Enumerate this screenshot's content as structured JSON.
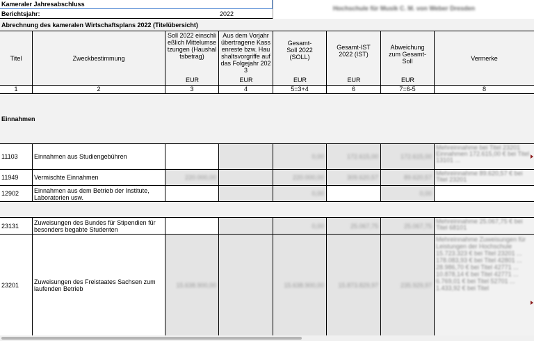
{
  "header": {
    "title": "Kameraler Jahresabschluss",
    "report_year_label": "Berichtsjahr:",
    "report_year": "2022",
    "institution": "Hochschule für Musik C. M. von Weber Dresden"
  },
  "section_title": "Abrechnung des kameralen Wirtschaftsplans  2022 (Titelübersicht)",
  "columns": [
    {
      "label": "Titel",
      "unit": "",
      "num": "1"
    },
    {
      "label": "Zweckbestimmung",
      "unit": "",
      "num": "2"
    },
    {
      "label": "Soll 2022 einschließlich Mittelumsetzungen (Haushaltsbetrag)",
      "unit": "EUR",
      "num": "3"
    },
    {
      "label": "Aus dem Vorjahr übertragene Kassenreste bzw. Haushaltsvorgriffe auf das Folgejahr 2023",
      "unit": "EUR",
      "num": "4"
    },
    {
      "label": "Gesamt-Soll 2022 (SOLL)",
      "unit": "EUR",
      "num": "5=3+4"
    },
    {
      "label": "Gesamt-IST 2022 (IST)",
      "unit": "EUR",
      "num": "6"
    },
    {
      "label": "Abweichung zum Gesamt-Soll",
      "unit": "EUR",
      "num": "7=6-5"
    },
    {
      "label": "Vermerke",
      "unit": "",
      "num": "8"
    }
  ],
  "group_label": "Einnahmen",
  "rows": [
    {
      "titel": "11103",
      "zweck": "Einnahmen aus Studiengebühren",
      "c3": "",
      "c4": "",
      "c5": "0,00",
      "c6": "172.615,00",
      "c7": "172.615,00",
      "note": "Mehreinnahme bei Titel 23201 Einnahmen 172.615,00 € bei Titel 13101 ..."
    },
    {
      "titel": "11949",
      "zweck": "Vermischte Einnahmen",
      "c3": "220.000,00",
      "c4": "",
      "c5": "220.000,00",
      "c6": "309.620,57",
      "c7": "89.620,57",
      "note": "Mehreinnahme 89.620,57 € bei Titel 23201"
    },
    {
      "titel": "12902",
      "zweck": "Einnahmen aus dem Betrieb der Institute, Laboratorien usw.",
      "c3": "",
      "c4": "",
      "c5": "0,00",
      "c6": "",
      "c7": "0,00",
      "note": ""
    },
    {
      "titel": "23131",
      "zweck": "Zuweisungen des Bundes für Stipendien für besonders begabte Studenten",
      "c3": "",
      "c4": "",
      "c5": "0,00",
      "c6": "25.067,75",
      "c7": "25.067,75",
      "note": "Mehreinnahme 25.067,75 € bei Titel 68101"
    },
    {
      "titel": "23201",
      "zweck": "Zuweisungen des Freistaates Sachsen zum laufenden Betrieb",
      "c3": "15.638.900,00",
      "c4": "",
      "c5": "15.638.900,00",
      "c6": "15.873.829,97",
      "c7": "235.929,97",
      "note": "Mehreinnahme Zuweisungen für Leistungen der Hochschule 15.723.323 € bei Titel 23201 ... 178.083,93 € bei Titel 42801 ... 28.986,70 € bei Titel 42771 ... 10.878,14 € bei Titel 42771 ... 6.769,01 € bei Titel 52701 ... 1.433,92 € bei Titel"
    }
  ]
}
